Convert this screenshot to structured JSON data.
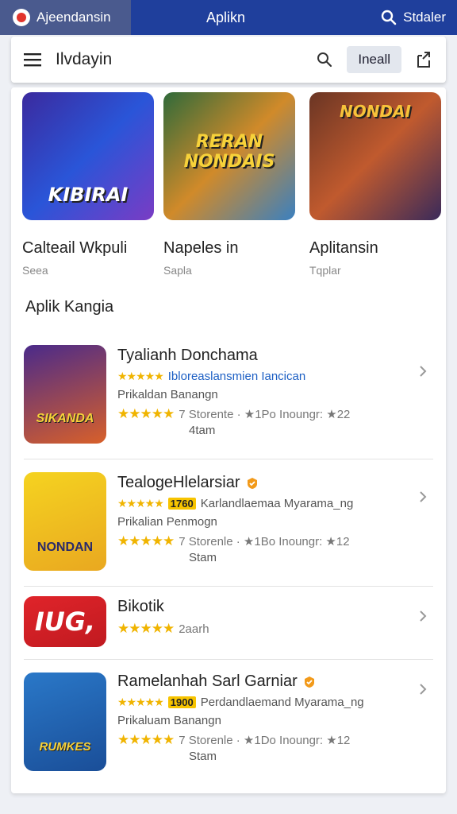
{
  "topbar": {
    "left_label": "Ajeendansin",
    "center_title": "Aplikn",
    "right_label": "Stdaler"
  },
  "header": {
    "title": "Ilvdayin",
    "install_label": "Ineall"
  },
  "featured": [
    {
      "name": "Calteail Wkpuli",
      "sub": "Seea",
      "art_text": "KIBIRAI",
      "colors": [
        "#3b2a9e",
        "#2a55d8",
        "#7a3cc4"
      ]
    },
    {
      "name": "Napeles in",
      "sub": "Sapla",
      "art_text": "RERAN NONDAIS",
      "colors": [
        "#2f6a3a",
        "#d08a2a",
        "#3a80c0"
      ]
    },
    {
      "name": "Aplitansin",
      "sub": "Tqplar",
      "art_text": "NONDAI",
      "colors": [
        "#6a3524",
        "#c05a2e",
        "#3a2a5a"
      ]
    }
  ],
  "section_title": "Aplik Kangia",
  "apps": [
    {
      "name": "Tyalianh Donchama",
      "line2": "Ibloreaslansmien Iancican",
      "line3": "Prikaldan Banangn",
      "stars": "★★★★★",
      "meta": "7 Storente · ★1Po Inoungr: ★22",
      "meta2": "4tam",
      "icon_text": "SIKANDA",
      "icon_colors": [
        "#4a2a8a",
        "#d8602a"
      ],
      "verified": false,
      "line2_badge": ""
    },
    {
      "name": "TealogeHlelarsiar",
      "line2": "Karlandlaemaa Myarama_ng",
      "line3": "Prikalian Penmogn",
      "stars": "★★★★★",
      "meta": "7 Storenle · ★1Bo Inoungr: ★12",
      "meta2": "Stam",
      "icon_text": "NONDAN",
      "icon_colors": [
        "#f5d320",
        "#e9a820"
      ],
      "verified": true,
      "line2_badge": "1760"
    },
    {
      "name": "Bikotik",
      "line2": "",
      "line3": "",
      "stars": "★★★★★",
      "meta": "2aarh",
      "meta2": "",
      "icon_text": "IUG,",
      "icon_colors": [
        "#e0242a",
        "#c01a20"
      ],
      "verified": false,
      "line2_badge": ""
    },
    {
      "name": "Ramelanhah Sarl Garniar",
      "line2": "Perdandlaemand Myarama_ng",
      "line3": "Prikaluam Banangn",
      "stars": "★★★★★",
      "meta": "7 Storenle · ★1Do Inoungr: ★12",
      "meta2": "Stam",
      "icon_text": "RUMKES",
      "icon_colors": [
        "#2a78c8",
        "#1a4e98"
      ],
      "verified": true,
      "line2_badge": "1900"
    }
  ],
  "colors": {
    "topbar": "#1f3f9c",
    "topbar_left": "#4a5a8e",
    "star": "#f0b400",
    "link_blue": "#1c5fc4"
  },
  "icons": [
    "app-logo-icon",
    "menu-icon",
    "search-icon",
    "share-icon",
    "chevron-right-icon",
    "verified-badge-icon"
  ]
}
